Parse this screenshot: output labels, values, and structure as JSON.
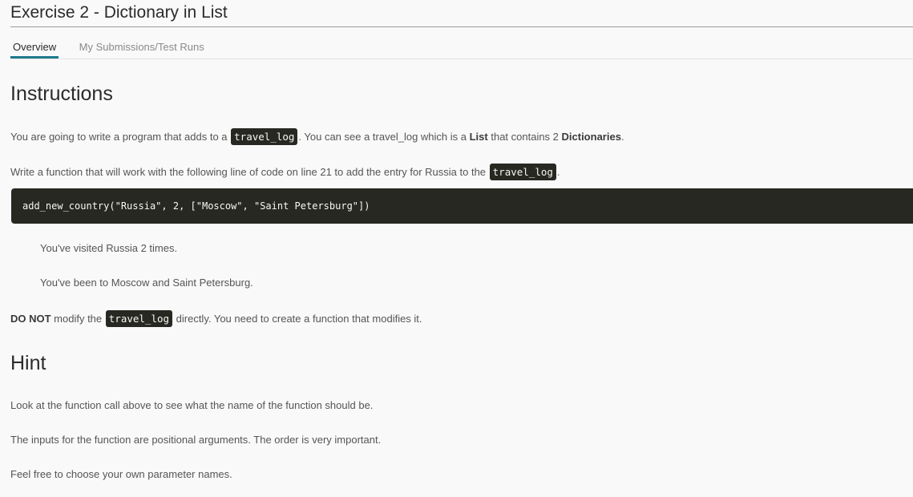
{
  "header": {
    "title": "Exercise 2 - Dictionary in List"
  },
  "tabs": [
    {
      "label": "Overview",
      "active": true
    },
    {
      "label": "My Submissions/Test Runs",
      "active": false
    }
  ],
  "instructions": {
    "heading": "Instructions",
    "p1": {
      "before_code": "You are going to write a program that adds to a ",
      "code": "travel_log",
      "middle": ". You can see a travel_log which is a ",
      "bold1": "List",
      "middle2": " that contains 2 ",
      "bold2": "Dictionaries",
      "end": "."
    },
    "p2": {
      "before_code": "Write a function that will work with the following line of code on line 21 to add the entry for Russia to the ",
      "code": "travel_log",
      "end": "."
    },
    "code_block": "add_new_country(\"Russia\", 2, [\"Moscow\", \"Saint Petersburg\"])",
    "output_line1": "You've visited Russia 2 times.",
    "output_line2": "You've been to Moscow and Saint Petersburg.",
    "p3": {
      "bold": "DO NOT",
      "before_code": " modify the ",
      "code": "travel_log",
      "end": " directly. You need to create a function that modifies it."
    }
  },
  "hint": {
    "heading": "Hint",
    "line1": "Look at the function call above to see what the name of the function should be.",
    "line2": "The inputs for the function are positional arguments. The order is very important.",
    "line3": "Feel free to choose your own parameter names."
  },
  "colors": {
    "accent": "#1f7a8c",
    "code_bg": "#272822",
    "page_bg": "#f9f9f9"
  }
}
